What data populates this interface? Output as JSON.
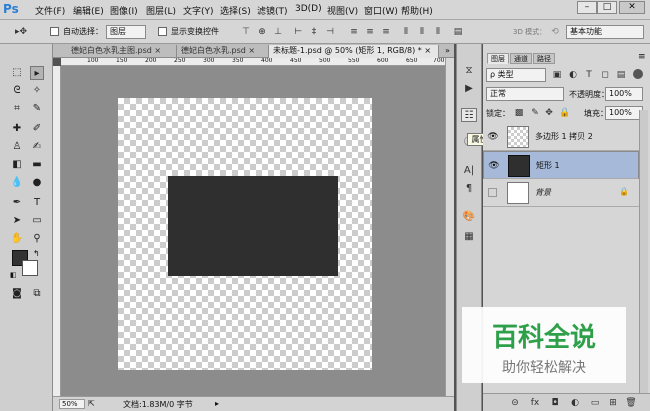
{
  "app": {
    "logo": "Ps"
  },
  "menu": [
    "文件(F)",
    "编辑(E)",
    "图像(I)",
    "图层(L)",
    "文字(Y)",
    "选择(S)",
    "滤镜(T)",
    "3D(D)",
    "视图(V)",
    "窗口(W)",
    "帮助(H)"
  ],
  "window_controls": {
    "minimize": "–",
    "maximize": "□",
    "close": "✕"
  },
  "options": {
    "auto_select_label": "自动选择：",
    "auto_select_value": "图层",
    "show_transform_label": "显示变换控件",
    "mode_3d_label": "3D 模式：",
    "workspace_value": "基本功能"
  },
  "tabs": [
    {
      "label": "德妃白色水乳主图.psd",
      "close": "×"
    },
    {
      "label": "德妃白色水乳.psd",
      "close": "×"
    },
    {
      "label": "未标题-1.psd @ 50% (矩形 1, RGB/8) *",
      "close": "×"
    }
  ],
  "ruler_ticks": [
    "100",
    "150",
    "200",
    "250",
    "300",
    "350",
    "400",
    "450",
    "500",
    "550",
    "600",
    "650",
    "700"
  ],
  "statusbar": {
    "zoom": "50%",
    "doc": "文档:1.83M/0 字节"
  },
  "tooltip": "属性",
  "panel": {
    "tabs": [
      "图层",
      "通道",
      "路径"
    ],
    "filter_value": "ρ 类型",
    "blend_mode": "正常",
    "opacity_label": "不透明度：",
    "opacity_value": "100%",
    "lock_label": "锁定：",
    "fill_label": "填充：",
    "fill_value": "100%",
    "layers": [
      {
        "name": "多边形 1 拷贝 2",
        "visible": true,
        "selected": false
      },
      {
        "name": "矩形 1",
        "visible": true,
        "selected": true
      },
      {
        "name": "背景",
        "visible": false,
        "selected": false
      }
    ]
  },
  "footer_icons": [
    "link-icon",
    "fx-icon",
    "mask-icon",
    "adjustment-icon",
    "group-icon",
    "new-layer-icon",
    "trash-icon"
  ],
  "watermark": {
    "title": "百科全说",
    "subtitle": "助你轻松解决"
  },
  "colors": {
    "menu_bg": "#d6d6d6",
    "workspace": "#8c8c8c",
    "selected_layer": "#a7b9d8",
    "rect": "#2f2f2f",
    "watermark_green": "#2fa04a"
  }
}
